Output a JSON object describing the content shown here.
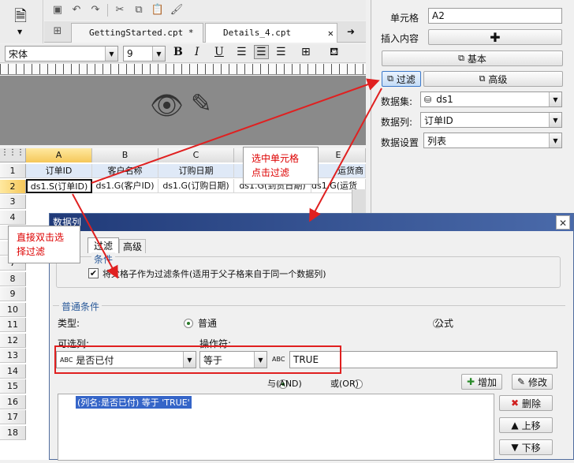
{
  "toolbar": {
    "icons": [
      "preview-icon",
      "save-icon",
      "undo-icon",
      "redo-icon",
      "cut-icon",
      "copy-icon",
      "paste-icon",
      "format-brush-icon"
    ]
  },
  "tabs": [
    {
      "label": "GettingStarted.cpt *"
    },
    {
      "label": "Details_4.cpt"
    }
  ],
  "font": {
    "family": "宋体",
    "size": "9",
    "bold": "B",
    "italic": "I",
    "underline": "U"
  },
  "sheet": {
    "columns": [
      "A",
      "B",
      "C",
      "D",
      "E"
    ],
    "rows": [
      "1",
      "2",
      "3",
      "4",
      "5",
      "6",
      "7",
      "8",
      "9",
      "10",
      "11",
      "12",
      "13",
      "14",
      "15",
      "16",
      "17",
      "18"
    ],
    "row1": [
      "订单ID",
      "客户名称",
      "订购日期",
      "",
      "运货商"
    ],
    "row2": [
      "ds1.S(订单ID)",
      "ds1.G(客户ID)",
      "ds1.G(订购日期)",
      "ds1.G(到货日期)",
      "ds1.G(运货"
    ]
  },
  "props": {
    "cell_label": "单元格",
    "cell_value": "A2",
    "insert_label": "插入内容",
    "basic_label": "基本",
    "filter_label": "过滤",
    "advanced_label": "高级",
    "dataset_label": "数据集:",
    "dataset_value": "ds1",
    "datacol_label": "数据列:",
    "datacol_value": "订单ID",
    "setting_label": "数据设置",
    "setting_value": "列表"
  },
  "dialog": {
    "title": "数据列",
    "tab_filter": "过滤",
    "tab_advanced": "高级",
    "group1_label": "条件",
    "parent_check": "将父格子作为过滤条件(适用于父子格来自于同一个数据列)",
    "group2_label": "普通条件",
    "type_label": "类型:",
    "type_normal": "普通",
    "type_formula": "公式",
    "optional_col_label": "可选列:",
    "operator_label": "操作符:",
    "col_value": "是否已付",
    "op_value": "等于",
    "val_value": "TRUE",
    "and_label": "与(AND)",
    "or_label": "或(OR)",
    "add_btn": "增加",
    "edit_btn": "修改",
    "delete_btn": "删除",
    "up_btn": "上移",
    "down_btn": "下移",
    "condition_item": "(列名:是否已付) 等于 'TRUE'"
  },
  "callouts": {
    "right": "选中单元格\n点击过滤",
    "left": "直接双击选\n择过滤"
  },
  "colors": {
    "accent": "#e02020",
    "dialog_title": "#203a78",
    "selected": "#3565c8"
  }
}
